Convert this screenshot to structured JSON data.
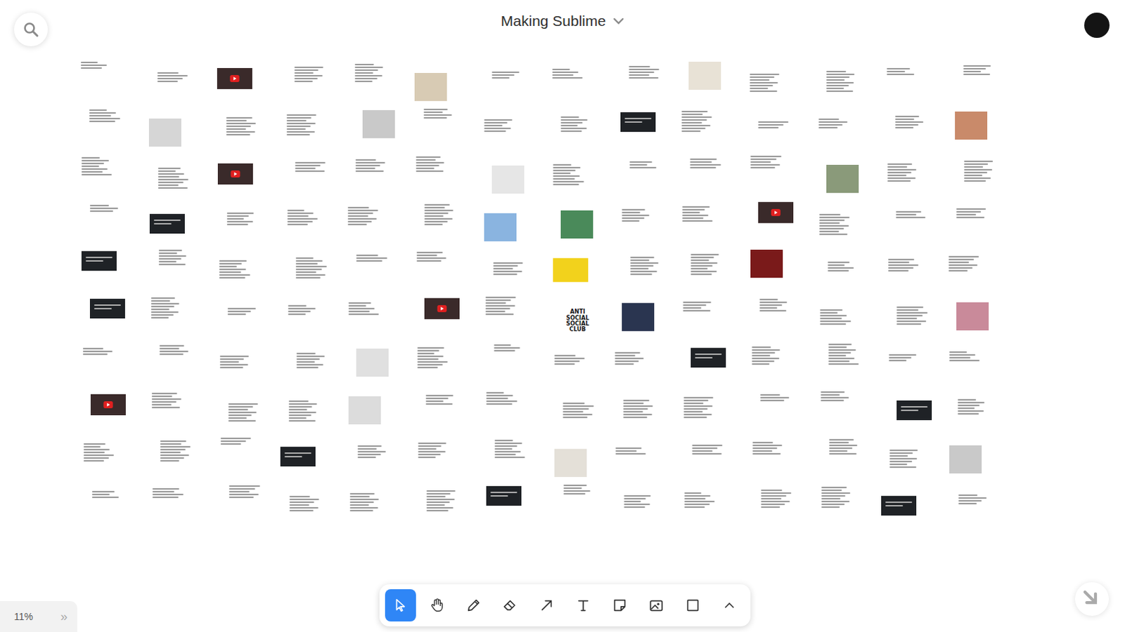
{
  "board": {
    "title": "Making Sublime"
  },
  "zoom": {
    "text": "11%",
    "expand": "»"
  },
  "tools": [
    {
      "kind": "select",
      "selected": true
    },
    {
      "kind": "hand",
      "selected": false
    },
    {
      "kind": "pen",
      "selected": false
    },
    {
      "kind": "eraser",
      "selected": false
    },
    {
      "kind": "arrow",
      "selected": false
    },
    {
      "kind": "text",
      "selected": false
    },
    {
      "kind": "note",
      "selected": false
    },
    {
      "kind": "media",
      "selected": false
    },
    {
      "kind": "shape",
      "selected": false
    },
    {
      "kind": "more",
      "selected": false
    }
  ],
  "cards": [
    {
      "kind": "text"
    },
    {
      "kind": "text"
    },
    {
      "kind": "video"
    },
    {
      "kind": "text"
    },
    {
      "kind": "text"
    },
    {
      "kind": "image",
      "color": "#d8cbb4"
    },
    {
      "kind": "text"
    },
    {
      "kind": "text"
    },
    {
      "kind": "text"
    },
    {
      "kind": "image",
      "color": "#e8e2d6"
    },
    {
      "kind": "text"
    },
    {
      "kind": "text"
    },
    {
      "kind": "text"
    },
    {
      "kind": "text"
    },
    {
      "kind": "text"
    },
    {
      "kind": "image",
      "color": "#d6d6d6"
    },
    {
      "kind": "text"
    },
    {
      "kind": "text"
    },
    {
      "kind": "image",
      "color": "#c9c9c9"
    },
    {
      "kind": "text"
    },
    {
      "kind": "text"
    },
    {
      "kind": "text"
    },
    {
      "kind": "dark"
    },
    {
      "kind": "text"
    },
    {
      "kind": "text"
    },
    {
      "kind": "text"
    },
    {
      "kind": "text"
    },
    {
      "kind": "image",
      "color": "#c98a6a"
    },
    {
      "kind": "text"
    },
    {
      "kind": "text"
    },
    {
      "kind": "video"
    },
    {
      "kind": "text"
    },
    {
      "kind": "text"
    },
    {
      "kind": "text"
    },
    {
      "kind": "image",
      "color": "#e6e6e6"
    },
    {
      "kind": "text"
    },
    {
      "kind": "text"
    },
    {
      "kind": "text"
    },
    {
      "kind": "text"
    },
    {
      "kind": "image",
      "color": "#8a9a7a"
    },
    {
      "kind": "text"
    },
    {
      "kind": "text"
    },
    {
      "kind": "text"
    },
    {
      "kind": "dark"
    },
    {
      "kind": "text"
    },
    {
      "kind": "text"
    },
    {
      "kind": "text"
    },
    {
      "kind": "text"
    },
    {
      "kind": "image",
      "color": "#8ab4e0"
    },
    {
      "kind": "image",
      "color": "#4a8a5a"
    },
    {
      "kind": "text"
    },
    {
      "kind": "text"
    },
    {
      "kind": "video"
    },
    {
      "kind": "text"
    },
    {
      "kind": "text"
    },
    {
      "kind": "text"
    },
    {
      "kind": "dark"
    },
    {
      "kind": "text"
    },
    {
      "kind": "text"
    },
    {
      "kind": "text"
    },
    {
      "kind": "text"
    },
    {
      "kind": "text"
    },
    {
      "kind": "text"
    },
    {
      "kind": "yellow"
    },
    {
      "kind": "text"
    },
    {
      "kind": "text"
    },
    {
      "kind": "image",
      "color": "#7a1a1a"
    },
    {
      "kind": "text"
    },
    {
      "kind": "text"
    },
    {
      "kind": "text"
    },
    {
      "kind": "dark"
    },
    {
      "kind": "text"
    },
    {
      "kind": "text"
    },
    {
      "kind": "text"
    },
    {
      "kind": "text"
    },
    {
      "kind": "video"
    },
    {
      "kind": "text"
    },
    {
      "kind": "label",
      "text": "ANTI SOCIAL SOCIAL CLUB"
    },
    {
      "kind": "image",
      "color": "#2a3550"
    },
    {
      "kind": "text"
    },
    {
      "kind": "text"
    },
    {
      "kind": "text"
    },
    {
      "kind": "text"
    },
    {
      "kind": "image",
      "color": "#c98a9a"
    },
    {
      "kind": "text"
    },
    {
      "kind": "text"
    },
    {
      "kind": "text"
    },
    {
      "kind": "text"
    },
    {
      "kind": "image",
      "color": "#e0e0e0"
    },
    {
      "kind": "text"
    },
    {
      "kind": "text"
    },
    {
      "kind": "text"
    },
    {
      "kind": "text"
    },
    {
      "kind": "dark"
    },
    {
      "kind": "text"
    },
    {
      "kind": "text"
    },
    {
      "kind": "text"
    },
    {
      "kind": "text"
    },
    {
      "kind": "video"
    },
    {
      "kind": "text"
    },
    {
      "kind": "text"
    },
    {
      "kind": "text"
    },
    {
      "kind": "image",
      "color": "#dcdcdc"
    },
    {
      "kind": "text"
    },
    {
      "kind": "text"
    },
    {
      "kind": "text"
    },
    {
      "kind": "text"
    },
    {
      "kind": "text"
    },
    {
      "kind": "text"
    },
    {
      "kind": "text"
    },
    {
      "kind": "dark"
    },
    {
      "kind": "text"
    },
    {
      "kind": "text"
    },
    {
      "kind": "text"
    },
    {
      "kind": "text"
    },
    {
      "kind": "dark"
    },
    {
      "kind": "text"
    },
    {
      "kind": "text"
    },
    {
      "kind": "text"
    },
    {
      "kind": "image",
      "color": "#e4e0d8"
    },
    {
      "kind": "text"
    },
    {
      "kind": "text"
    },
    {
      "kind": "text"
    },
    {
      "kind": "text"
    },
    {
      "kind": "text"
    },
    {
      "kind": "image",
      "color": "#c9c9c9"
    },
    {
      "kind": "text"
    },
    {
      "kind": "text"
    },
    {
      "kind": "text"
    },
    {
      "kind": "text"
    },
    {
      "kind": "text"
    },
    {
      "kind": "text"
    },
    {
      "kind": "dark"
    },
    {
      "kind": "text"
    },
    {
      "kind": "text"
    },
    {
      "kind": "text"
    },
    {
      "kind": "text"
    },
    {
      "kind": "text"
    },
    {
      "kind": "dark"
    },
    {
      "kind": "text"
    }
  ]
}
